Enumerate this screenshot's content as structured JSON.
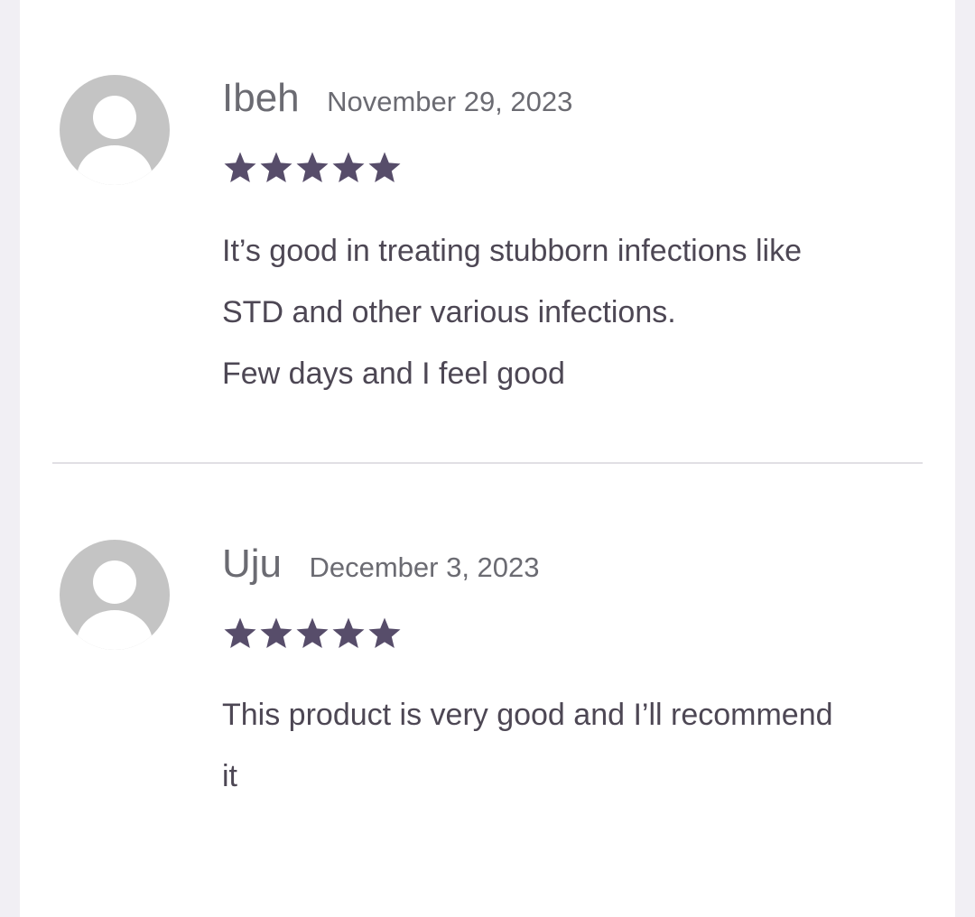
{
  "reviews": [
    {
      "author": "Ibeh",
      "date": "November 29, 2023",
      "rating": 5,
      "rating_max": 5,
      "text_lines": [
        "It’s good in treating stubborn infections like",
        "STD and other various infections.",
        "Few days and I feel good"
      ]
    },
    {
      "author": "Uju",
      "date": "December 3, 2023",
      "rating": 5,
      "rating_max": 5,
      "text_lines": [
        "This product is very good and I’ll recommend",
        "it"
      ]
    }
  ],
  "colors": {
    "background": "#f1eff4",
    "panel": "#ffffff",
    "star": "#574d6a",
    "text": "#4d4754",
    "meta": "#6b6b72",
    "avatar_bg": "#c4c4c4",
    "divider": "#e1dfe4"
  },
  "icons": {
    "avatar": "default-user-avatar-icon",
    "star": "star-icon"
  }
}
